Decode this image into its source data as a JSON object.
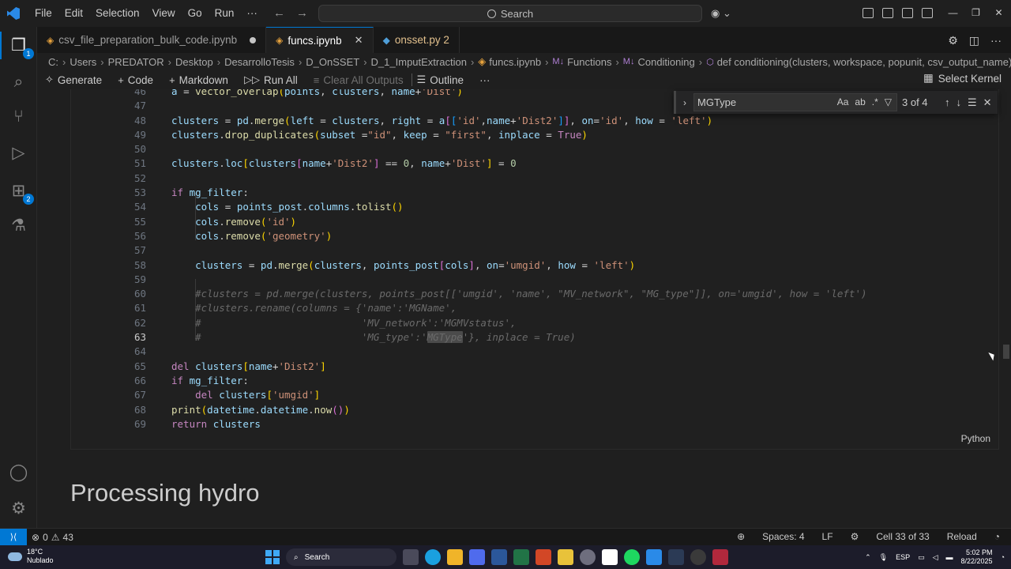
{
  "menu": [
    "File",
    "Edit",
    "Selection",
    "View",
    "Go",
    "Run",
    "···"
  ],
  "command_center": {
    "placeholder": "Search"
  },
  "activity_badges": {
    "explorer": "1",
    "extensions": "2"
  },
  "tabs": [
    {
      "label": "csv_file_preparation_bulk_code.ipynb",
      "state": "modified"
    },
    {
      "label": "funcs.ipynb",
      "state": "active"
    },
    {
      "label": "onsset.py 2",
      "state": "problems"
    }
  ],
  "breadcrumb": [
    "C:",
    "Users",
    "PREDATOR",
    "Desktop",
    "DesarrolloTesis",
    "D_OnSSET",
    "D_1_ImputExtraction",
    "funcs.ipynb",
    "Functions",
    "Conditioning",
    "def conditioning(clusters, workspace, popunit, csv_output_name):"
  ],
  "breadcrumb_markers": {
    "md": "M↓"
  },
  "notebook_toolbar": {
    "generate": "Generate",
    "code": "Code",
    "markdown": "Markdown",
    "run_all": "Run All",
    "clear_outputs": "Clear All Outputs",
    "outline": "Outline",
    "more": "···",
    "select_kernel": "Select Kernel"
  },
  "find_widget": {
    "query": "MGType",
    "count": "3 of 4",
    "opt_case": "Aa",
    "opt_word": "ab",
    "opt_regex": ".*"
  },
  "code_lines": [
    {
      "n": "46",
      "html": "<span class='var'>a</span> <span class='op'>=</span> <span class='fn'>vector_overlap</span><span class='br1'>(</span><span class='var'>points</span>, <span class='var'>clusters</span>, <span class='var'>name</span><span class='op'>+</span><span class='str'>'Dist'</span><span class='br1'>)</span>"
    },
    {
      "n": "47",
      "html": ""
    },
    {
      "n": "48",
      "html": "<span class='var'>clusters</span> <span class='op'>=</span> <span class='var'>pd</span>.<span class='fn'>merge</span><span class='br1'>(</span><span class='var'>left</span> <span class='op'>=</span> <span class='var'>clusters</span>, <span class='var'>right</span> <span class='op'>=</span> <span class='var'>a</span><span class='br2'>[</span><span class='br3'>[</span><span class='str'>'id'</span>,<span class='var'>name</span><span class='op'>+</span><span class='str'>'Dist2'</span><span class='br3'>]</span><span class='br2'>]</span>, <span class='var'>on</span><span class='op'>=</span><span class='str'>'id'</span>, <span class='var'>how</span> <span class='op'>=</span> <span class='str'>'left'</span><span class='br1'>)</span>"
    },
    {
      "n": "49",
      "html": "<span class='var'>clusters</span>.<span class='fn'>drop_duplicates</span><span class='br1'>(</span><span class='var'>subset</span> <span class='op'>=</span><span class='str'>\"id\"</span>, <span class='var'>keep</span> <span class='op'>=</span> <span class='str'>\"first\"</span>, <span class='var'>inplace</span> <span class='op'>=</span> <span class='kw'>True</span><span class='br1'>)</span>"
    },
    {
      "n": "50",
      "html": ""
    },
    {
      "n": "51",
      "html": "<span class='var'>clusters</span>.<span class='var'>loc</span><span class='br1'>[</span><span class='var'>clusters</span><span class='br2'>[</span><span class='var'>name</span><span class='op'>+</span><span class='str'>'Dist2'</span><span class='br2'>]</span> <span class='op'>==</span> <span class='num'>0</span>, <span class='var'>name</span><span class='op'>+</span><span class='str'>'Dist'</span><span class='br1'>]</span> <span class='op'>=</span> <span class='num'>0</span>"
    },
    {
      "n": "52",
      "html": ""
    },
    {
      "n": "53",
      "html": "<span class='kw'>if</span> <span class='var'>mg_filter</span>:"
    },
    {
      "n": "54",
      "html": "    <span class='var'>cols</span> <span class='op'>=</span> <span class='var'>points_post</span>.<span class='var'>columns</span>.<span class='fn'>tolist</span><span class='br1'>()</span>"
    },
    {
      "n": "55",
      "html": "    <span class='var'>cols</span>.<span class='fn'>remove</span><span class='br1'>(</span><span class='str'>'id'</span><span class='br1'>)</span>"
    },
    {
      "n": "56",
      "html": "    <span class='var'>cols</span>.<span class='fn'>remove</span><span class='br1'>(</span><span class='str'>'geometry'</span><span class='br1'>)</span>"
    },
    {
      "n": "57",
      "html": ""
    },
    {
      "n": "58",
      "html": "    <span class='var'>clusters</span> <span class='op'>=</span> <span class='var'>pd</span>.<span class='fn'>merge</span><span class='br1'>(</span><span class='var'>clusters</span>, <span class='var'>points_post</span><span class='br2'>[</span><span class='var'>cols</span><span class='br2'>]</span>, <span class='var'>on</span><span class='op'>=</span><span class='str'>'umgid'</span>, <span class='var'>how</span> <span class='op'>=</span> <span class='str'>'left'</span><span class='br1'>)</span>"
    },
    {
      "n": "59",
      "html": ""
    },
    {
      "n": "60",
      "html": "    <span class='cm'>#clusters = pd.merge(clusters, points_post[['umgid', 'name', \"MV_network\", \"MG_type\"]], on='umgid', how = 'left')</span>"
    },
    {
      "n": "61",
      "html": "    <span class='cm'>#clusters.rename(columns = {'name':'MGName',</span>"
    },
    {
      "n": "62",
      "html": "    <span class='cm'>#                           'MV_network':'MGMVstatus',</span>"
    },
    {
      "n": "63",
      "html": "    <span class='cm'>#                           'MG_type':'<span class='hl'>MGType</span>'}, inplace = True)</span>"
    },
    {
      "n": "64",
      "html": ""
    },
    {
      "n": "65",
      "html": "<span class='kw'>del</span> <span class='var'>clusters</span><span class='br1'>[</span><span class='var'>name</span><span class='op'>+</span><span class='str'>'Dist2'</span><span class='br1'>]</span>"
    },
    {
      "n": "66",
      "html": "<span class='kw'>if</span> <span class='var'>mg_filter</span>:"
    },
    {
      "n": "67",
      "html": "    <span class='kw'>del</span> <span class='var'>clusters</span><span class='br1'>[</span><span class='str'>'umgid'</span><span class='br1'>]</span>"
    },
    {
      "n": "68",
      "html": "<span class='fn'>print</span><span class='br1'>(</span><span class='var'>datetime</span>.<span class='var'>datetime</span>.<span class='fn'>now</span><span class='br2'>()</span><span class='br1'>)</span>"
    },
    {
      "n": "69",
      "html": "<span class='kw'>return</span> <span class='var'>clusters</span>"
    }
  ],
  "cell_language": "Python",
  "markdown_heading": "Processing hydro",
  "status_bar": {
    "errors": "0",
    "warnings": "43",
    "spaces": "Spaces: 4",
    "eol": "LF",
    "cell": "Cell 33 of 33",
    "reload": "Reload"
  },
  "taskbar": {
    "temperature": "18°C",
    "weather": "Nublado",
    "search": "Search",
    "language": "ESP",
    "time": "5:02 PM",
    "date": "8/22/2025"
  },
  "colors": {
    "accent": "#0078d4",
    "editor_bg": "#1f1f1f"
  }
}
